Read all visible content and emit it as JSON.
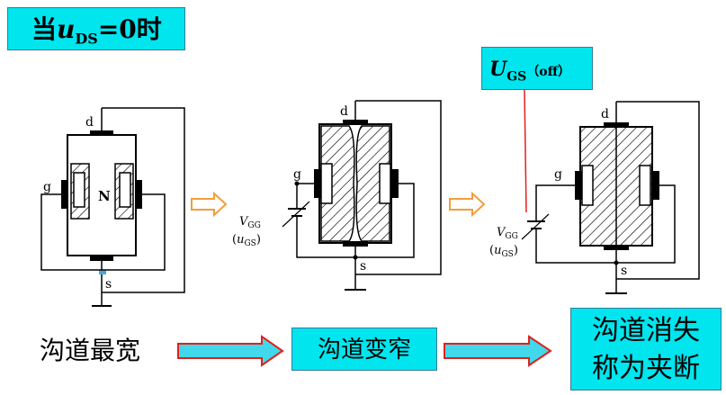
{
  "title": {
    "prefix": "当",
    "var": "u",
    "sub": "DS",
    "suffix": "=0时"
  },
  "pinch_label": {
    "var": "U",
    "sub": "GS",
    "paren": "（off）"
  },
  "labels": {
    "drain": "d",
    "gate": "g",
    "source": "s",
    "channel": "N",
    "vgg_var": "V",
    "vgg_sub": "GG",
    "ugs_open": "(",
    "ugs_var": "u",
    "ugs_sub": "GS",
    "ugs_close": ")"
  },
  "captions": {
    "widest": "沟道最宽",
    "narrow": "沟道变窄",
    "pinch_line1": "沟道消失",
    "pinch_line2": "称为夹断"
  },
  "colors": {
    "box_fill": "#00e5ee",
    "arrow_fill": "#40d8ea",
    "arrow_stroke": "#e0201b",
    "orange": "#f39c3b",
    "pointer": "#e0201b"
  }
}
